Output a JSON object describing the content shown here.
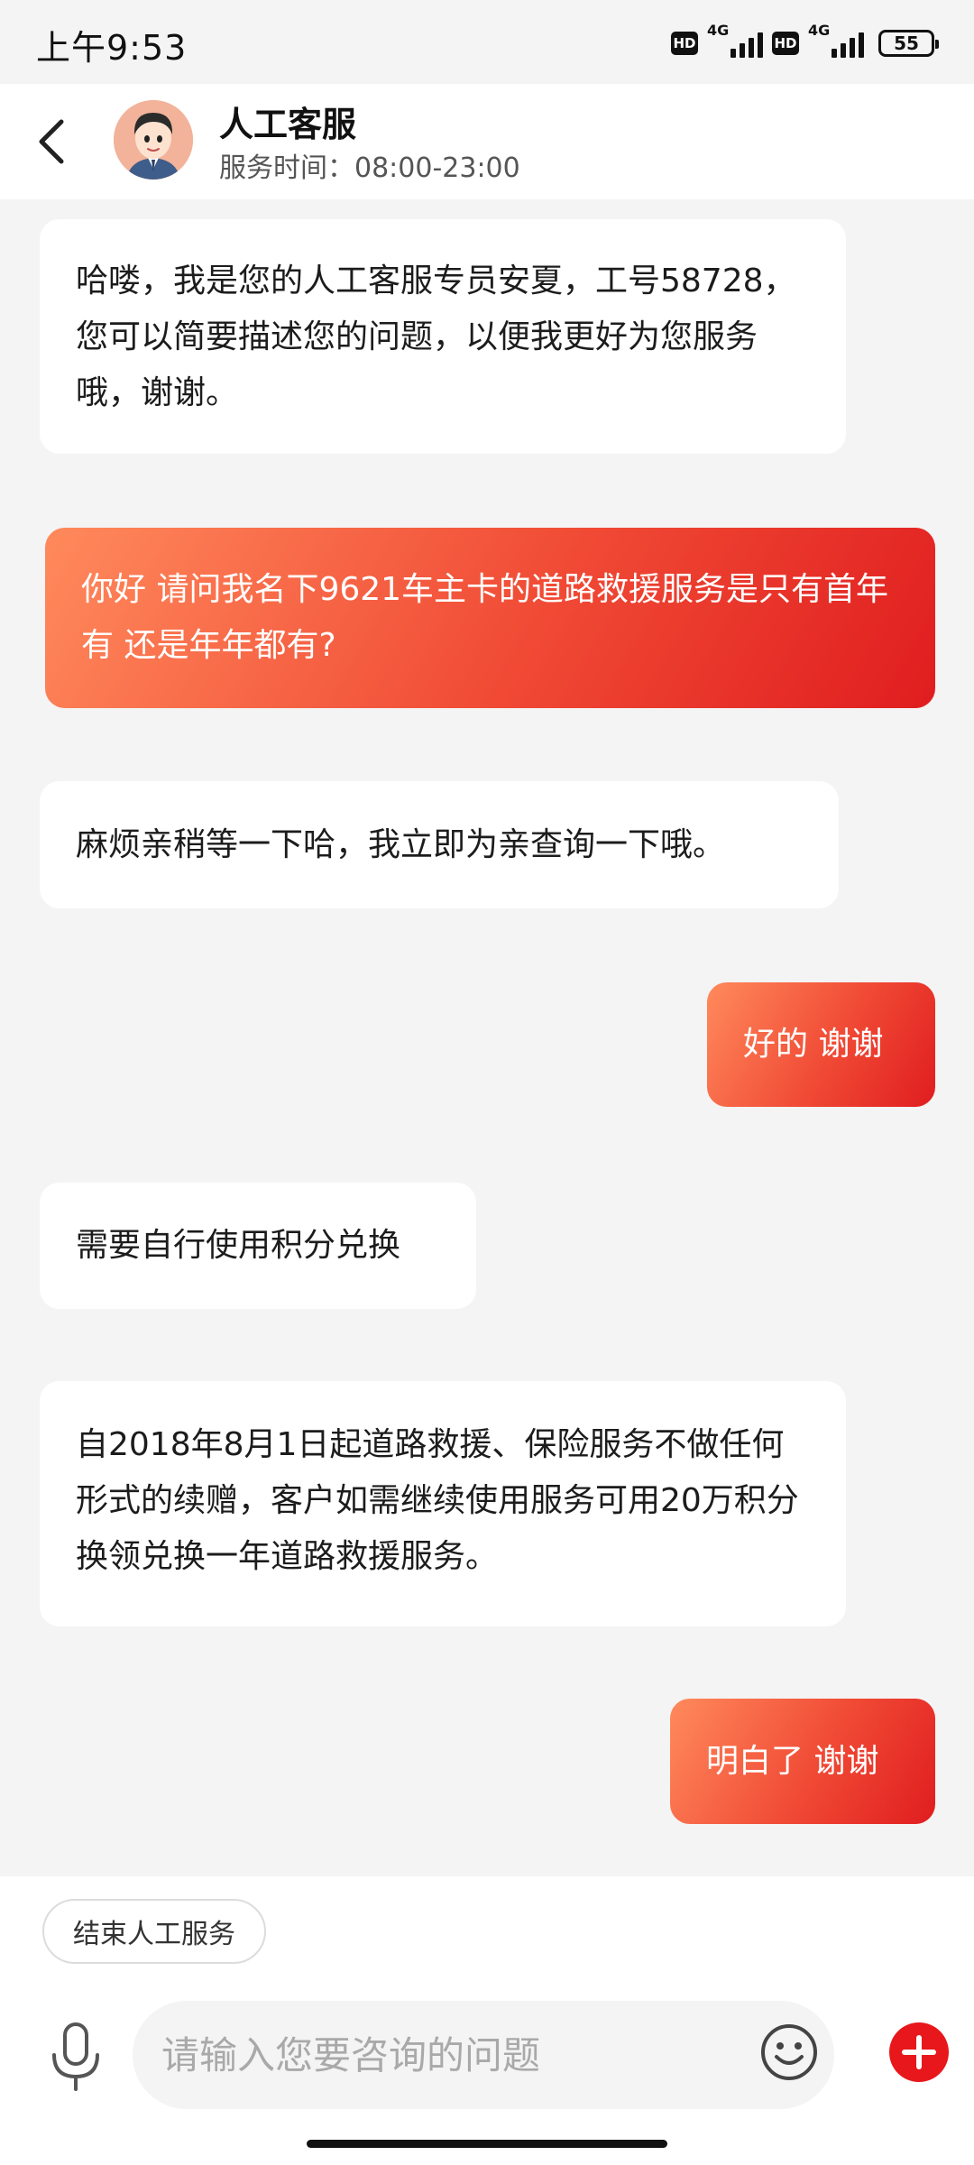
{
  "status_bar": {
    "time": "上午9:53",
    "hd1": "HD",
    "net1": "4G",
    "hd2": "HD",
    "net2": "4G",
    "battery": "55"
  },
  "header": {
    "title": "人工客服",
    "service_hours": "服务时间：08:00-23:00"
  },
  "messages": [
    {
      "from": "agent",
      "text": "哈喽，我是您的人工客服专员安夏，工号58728，您可以简要描述您的问题，以便我更好为您服务哦，谢谢。"
    },
    {
      "from": "user",
      "text": "你好 请问我名下9621车主卡的道路救援服务是只有首年有 还是年年都有?"
    },
    {
      "from": "agent",
      "text": "麻烦亲稍等一下哈，我立即为亲查询一下哦。"
    },
    {
      "from": "user",
      "text": "好的 谢谢"
    },
    {
      "from": "agent",
      "text": "需要自行使用积分兑换"
    },
    {
      "from": "agent",
      "text": "自2018年8月1日起道路救援、保险服务不做任何形式的续赠，客户如需继续使用服务可用20万积分换领兑换一年道路救援服务。"
    },
    {
      "from": "user",
      "text": "明白了 谢谢"
    }
  ],
  "bottom": {
    "end_service_label": "结束人工服务",
    "input_placeholder": "请输入您要咨询的问题",
    "input_value": ""
  },
  "colors": {
    "accent": "#e8171b",
    "user_bubble_start": "#ff8a5c",
    "user_bubble_end": "#e01d1f",
    "background": "#f4f4f4"
  },
  "icons": {
    "back": "chevron-left-icon",
    "mic": "microphone-icon",
    "emoji": "smiley-icon",
    "plus": "plus-icon"
  }
}
